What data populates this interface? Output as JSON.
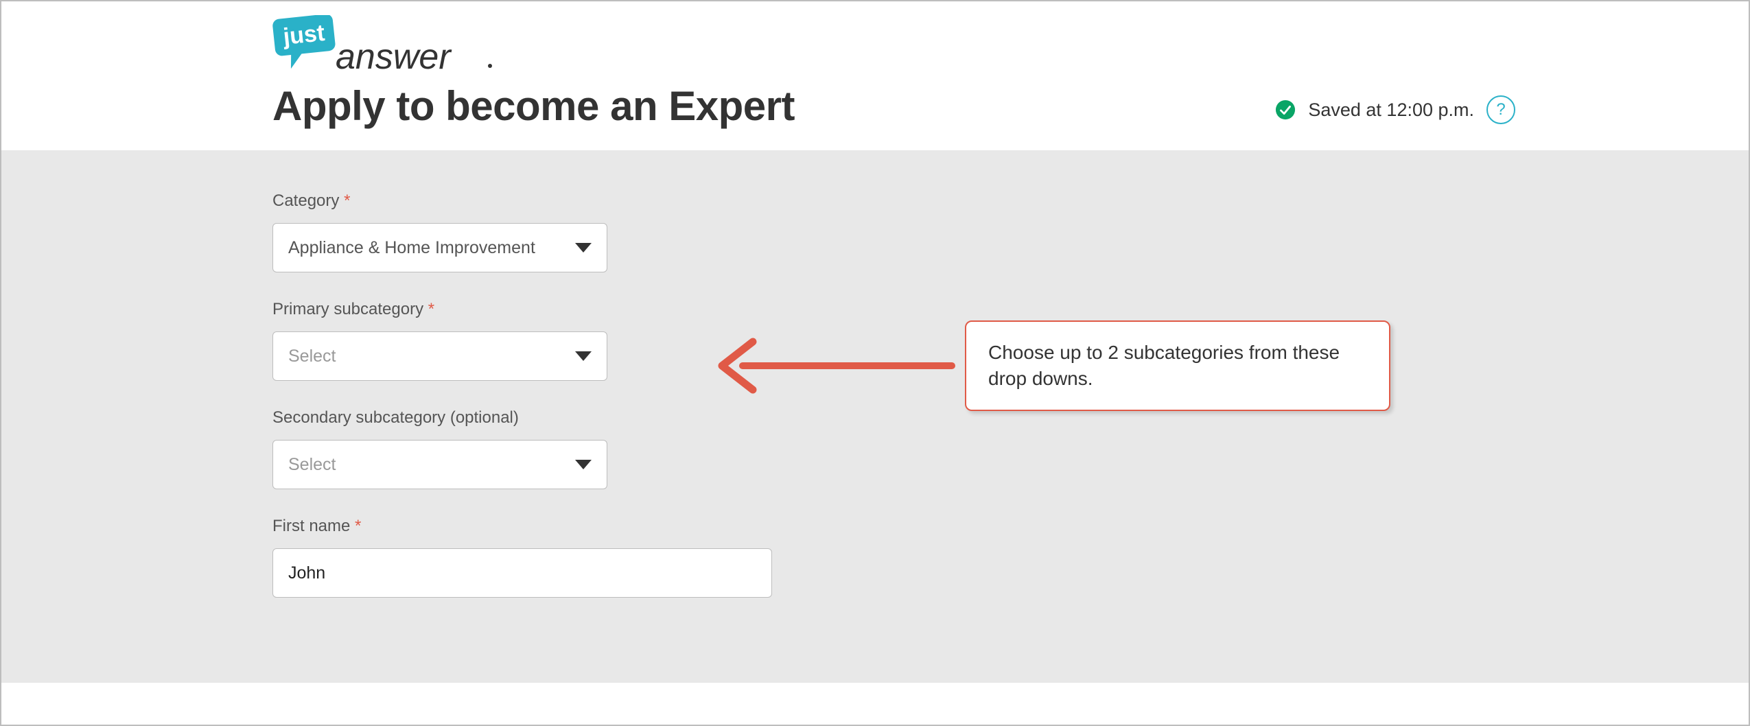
{
  "logo": {
    "just": "just",
    "answer": "answer"
  },
  "header": {
    "title": "Apply to become an Expert",
    "saved_text": "Saved at 12:00 p.m.",
    "help_char": "?"
  },
  "form": {
    "category": {
      "label": "Category",
      "required_mark": "*",
      "value": "Appliance & Home Improvement"
    },
    "primary": {
      "label": "Primary subcategory",
      "required_mark": "*",
      "placeholder": "Select"
    },
    "secondary": {
      "label": "Secondary subcategory (optional)",
      "placeholder": "Select"
    },
    "first_name": {
      "label": "First name",
      "required_mark": "*",
      "value": "John"
    }
  },
  "callout": {
    "text": "Choose up to 2 subcategories from these drop downs."
  }
}
